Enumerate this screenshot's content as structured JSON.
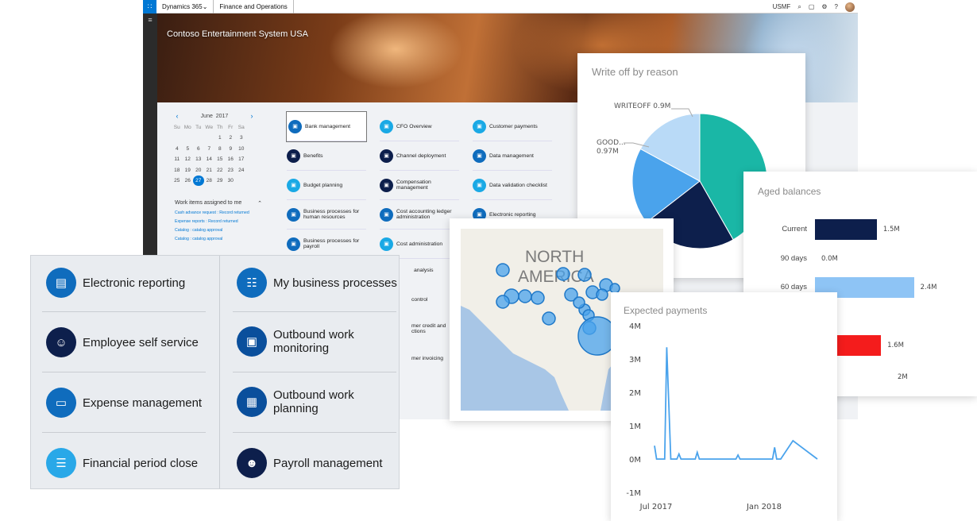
{
  "topbar": {
    "app_name": "Dynamics 365",
    "module": "Finance and Operations",
    "company": "USMF"
  },
  "banner": {
    "title": "Contoso Entertainment System USA"
  },
  "calendar": {
    "month": "June",
    "year": "2017",
    "weekdays": [
      "Su",
      "Mo",
      "Tu",
      "We",
      "Th",
      "Fr",
      "Sa"
    ],
    "days": [
      "",
      "",
      "",
      "",
      "1",
      "2",
      "3",
      "4",
      "5",
      "6",
      "7",
      "8",
      "9",
      "10",
      "11",
      "12",
      "13",
      "14",
      "15",
      "16",
      "17",
      "18",
      "19",
      "20",
      "21",
      "22",
      "23",
      "24",
      "25",
      "26",
      "27",
      "28",
      "29",
      "30",
      ""
    ],
    "today": "27"
  },
  "work_items": {
    "title": "Work items assigned to me",
    "items": [
      "Cash advance request : Record returned",
      "Expense reports : Record returned",
      "Catalog : catalog approval",
      "Catalog : catalog approval"
    ]
  },
  "tiles": {
    "col1": [
      {
        "label": "Bank management",
        "color": "blue",
        "selected": true
      },
      {
        "label": "Benefits",
        "color": "navy"
      },
      {
        "label": "Budget planning",
        "color": "light"
      },
      {
        "label": "Business processes for human resources",
        "color": "blue"
      },
      {
        "label": "Business processes for payroll",
        "color": "blue"
      }
    ],
    "col2": [
      {
        "label": "CFO Overview",
        "color": "light"
      },
      {
        "label": "Channel deployment",
        "color": "navy"
      },
      {
        "label": "Compensation management",
        "color": "navy"
      },
      {
        "label": "Cost accounting ledger administration",
        "color": "blue"
      },
      {
        "label": "Cost administration",
        "color": "light"
      }
    ],
    "col3": [
      {
        "label": "Customer payments",
        "color": "light"
      },
      {
        "label": "Data management",
        "color": "blue"
      },
      {
        "label": "Data validation checklist",
        "color": "light"
      },
      {
        "label": "Electronic reporting",
        "color": "blue"
      }
    ],
    "col2_hidden_fragments": [
      "analysis",
      "control",
      "mer credit and ctions",
      "mer invoicing"
    ]
  },
  "workspace": {
    "left": [
      {
        "label": "Electronic reporting",
        "icon": "report-icon",
        "color": "blue"
      },
      {
        "label": "Employee self service",
        "icon": "person-icon",
        "color": "navy"
      },
      {
        "label": "Expense management",
        "icon": "card-icon",
        "color": "blue"
      },
      {
        "label": "Financial period close",
        "icon": "list-icon",
        "color": "sky"
      }
    ],
    "right": [
      {
        "label": "My business processes",
        "icon": "id-card-icon",
        "color": "blue"
      },
      {
        "label": "Outbound work monitoring",
        "icon": "truck-icon",
        "color": "mid"
      },
      {
        "label": "Outbound work planning",
        "icon": "calendar-truck-icon",
        "color": "mid"
      },
      {
        "label": "Payroll management",
        "icon": "people-icon",
        "color": "navy"
      }
    ]
  },
  "chart_data": [
    {
      "type": "pie",
      "title": "Write off by reason",
      "slices": [
        {
          "label": "",
          "value": 2.2,
          "color": "#1ab7a6"
        },
        {
          "label": "",
          "value": 1.2,
          "color": "#0d1f4c"
        },
        {
          "label": "GOOD... 0.97M",
          "value": 0.97,
          "color": "#4aa3ec"
        },
        {
          "label": "WRITEOFF 0.9M",
          "value": 0.9,
          "color": "#b9daf7"
        }
      ]
    },
    {
      "type": "bar",
      "title": "Aged balances",
      "categories": [
        "Current",
        "90 days",
        "60 days",
        ""
      ],
      "values": [
        1.5,
        0.0,
        2.4,
        1.6
      ],
      "value_labels": [
        "1.5M",
        "0.0M",
        "2.4M",
        "1.6M"
      ],
      "colors": [
        "#0d1f4c",
        "#0d1f4c",
        "#8ec4f5",
        "#f41c1c"
      ],
      "axis_tick": "2M",
      "xlim": [
        0,
        2.6
      ]
    },
    {
      "type": "line",
      "title": "Expected payments",
      "y_ticks": [
        "4M",
        "3M",
        "2M",
        "1M",
        "0M",
        "-1M"
      ],
      "ylim": [
        -1,
        4
      ],
      "x_ticks": [
        "Jul 2017",
        "Jan 2018"
      ],
      "color": "#4aa3ec",
      "series": [
        {
          "points": [
            [
              0,
              0.4
            ],
            [
              0.5,
              0.0
            ],
            [
              1.5,
              0.0
            ],
            [
              2.5,
              0.0
            ],
            [
              3,
              3.35
            ],
            [
              4,
              0.0
            ],
            [
              5.5,
              0.0
            ],
            [
              6,
              0.15
            ],
            [
              6.5,
              0.0
            ],
            [
              10,
              0.0
            ],
            [
              10.5,
              0.2
            ],
            [
              11,
              0.0
            ],
            [
              20,
              0.0
            ],
            [
              20.5,
              0.12
            ],
            [
              21,
              0.0
            ],
            [
              29,
              0.0
            ],
            [
              29.5,
              0.35
            ],
            [
              30,
              0.0
            ],
            [
              31,
              0.0
            ],
            [
              34,
              0.55
            ],
            [
              40,
              0.0
            ]
          ]
        }
      ]
    }
  ],
  "map": {
    "label_line1": "NORTH",
    "label_line2": "AMERICA"
  }
}
